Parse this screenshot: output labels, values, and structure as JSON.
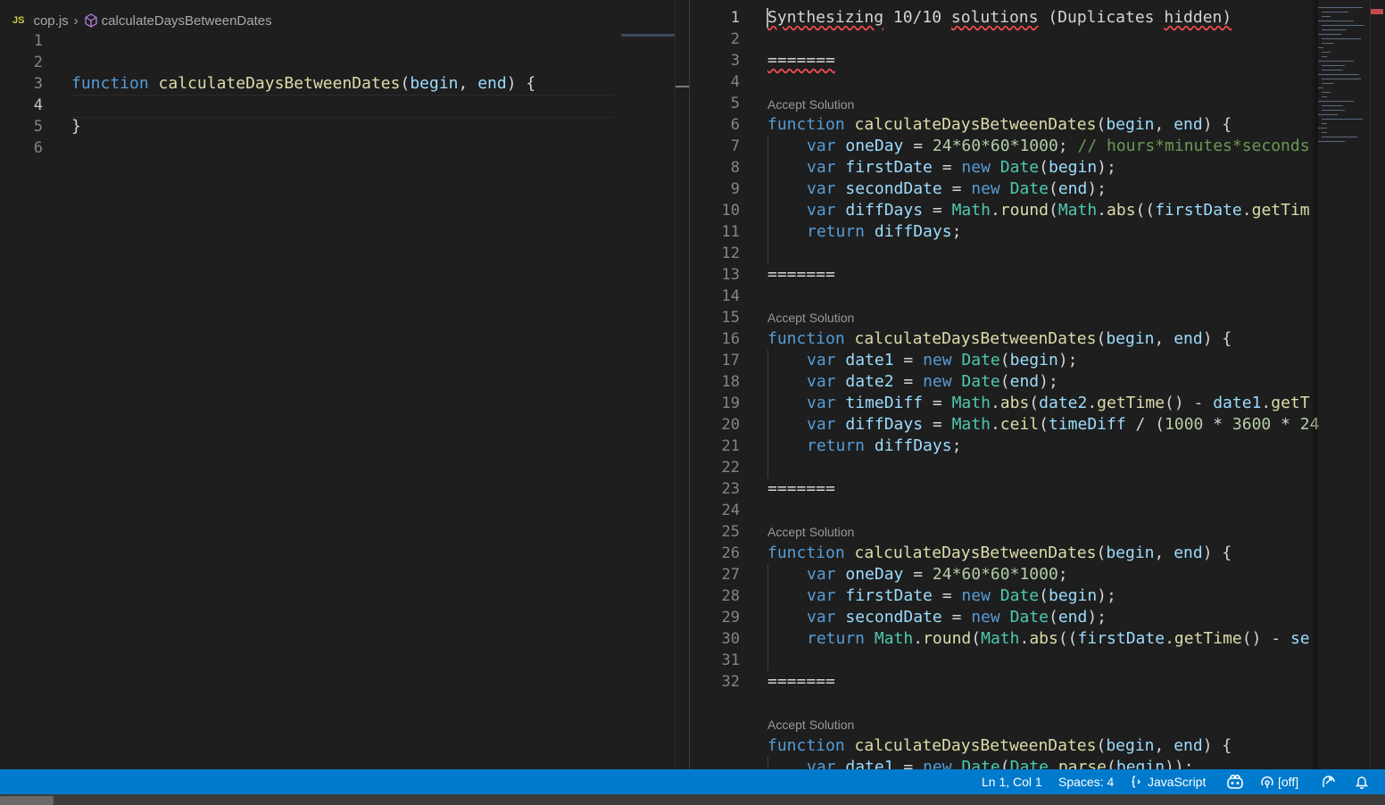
{
  "left_editor": {
    "breadcrumb": {
      "file_badge": "JS",
      "file_name": "cop.js",
      "symbol": "calculateDaysBetweenDates"
    },
    "line_numbers": [
      "1",
      "2",
      "3",
      "4",
      "5",
      "6"
    ],
    "active_line": "4",
    "code": {
      "l3_keyword": "function",
      "l3_name": "calculateDaysBetweenDates",
      "l3_open": "(",
      "l3_param1": "begin",
      "l3_comma": ", ",
      "l3_param2": "end",
      "l3_close": ") {",
      "l5": "}"
    }
  },
  "right_editor": {
    "header_words": [
      "Synthesizing",
      "10/10",
      "solutions",
      "(Duplicates",
      "hidden)"
    ],
    "separator": "=======",
    "accept_label": "Accept Solution",
    "line_numbers": [
      "1",
      "2",
      "3",
      "4",
      "5",
      "6",
      "7",
      "8",
      "9",
      "10",
      "11",
      "12",
      "13",
      "14",
      "15",
      "16",
      "17",
      "18",
      "19",
      "20",
      "21",
      "22",
      "23",
      "24",
      "25",
      "26",
      "27",
      "28",
      "29",
      "30",
      "31",
      "32"
    ],
    "sig": {
      "kw": "function",
      "name": "calculateDaysBetweenDates",
      "open": "(",
      "p1": "begin",
      "comma": ", ",
      "p2": "end",
      "close": ") {"
    },
    "s1": {
      "l6": {
        "kw": "var",
        "v": "oneDay",
        "rest": " = ",
        "n": "24*60*60*1000",
        "semi": "; ",
        "cmt": "// hours*minutes*seconds"
      },
      "l7": {
        "kw": "var",
        "v": "firstDate",
        "eq": " = ",
        "new": "new",
        "cls": "Date",
        "args": "(",
        "arg": "begin",
        "end": ");"
      },
      "l8": {
        "kw": "var",
        "v": "secondDate",
        "eq": " = ",
        "new": "new",
        "cls": "Date",
        "args": "(",
        "arg": "end",
        "end": ");"
      },
      "l9": {
        "kw": "var",
        "v": "diffDays",
        "eq": " = ",
        "m1": "Math",
        "d1": ".",
        "f1": "round",
        "o1": "(",
        "m2": "Math",
        "d2": ".",
        "f2": "abs",
        "o2": "((",
        "v2": "firstDate",
        "d3": ".",
        "f3": "getTim"
      },
      "l10": {
        "kw": "return",
        "v": "diffDays",
        "semi": ";"
      }
    },
    "s2": {
      "l15": {
        "kw": "var",
        "v": "date1",
        "eq": " = ",
        "new": "new",
        "cls": "Date",
        "o": "(",
        "arg": "begin",
        "end": ");"
      },
      "l16": {
        "kw": "var",
        "v": "date2",
        "eq": " = ",
        "new": "new",
        "cls": "Date",
        "o": "(",
        "arg": "end",
        "end": ");"
      },
      "l17": {
        "kw": "var",
        "v": "timeDiff",
        "eq": " = ",
        "m": "Math",
        "d": ".",
        "f": "abs",
        "o": "(",
        "v2": "date2",
        "d2": ".",
        "f2": "getTime",
        "o2": "() - ",
        "v3": "date1",
        "d3": ".",
        "f3": "getT"
      },
      "l18": {
        "kw": "var",
        "v": "diffDays",
        "eq": " = ",
        "m": "Math",
        "d": ".",
        "f": "ceil",
        "o": "(",
        "v2": "timeDiff",
        "op": " / (",
        "n1": "1000",
        "x1": " * ",
        "n2": "3600",
        "x2": " * ",
        "n3": "24"
      },
      "l19": {
        "kw": "return",
        "v": "diffDays",
        "semi": ";"
      }
    },
    "s3": {
      "l24": {
        "kw": "var",
        "v": "oneDay",
        "eq": " = ",
        "n": "24*60*60*1000",
        "semi": ";"
      },
      "l25": {
        "kw": "var",
        "v": "firstDate",
        "eq": " = ",
        "new": "new",
        "cls": "Date",
        "o": "(",
        "arg": "begin",
        "end": ");"
      },
      "l26": {
        "kw": "var",
        "v": "secondDate",
        "eq": " = ",
        "new": "new",
        "cls": "Date",
        "o": "(",
        "arg": "end",
        "end": ");"
      },
      "l27": {
        "kw": "return",
        "m": "Math",
        "d": ".",
        "f": "round",
        "o": "(",
        "m2": "Math",
        "d2": ".",
        "f2": "abs",
        "o2": "((",
        "v2": "firstDate",
        "d3": ".",
        "f3": "getTime",
        "o3": "() - ",
        "v3": "se"
      }
    },
    "s4": {
      "l32": {
        "kw": "var",
        "v": "date1",
        "eq": " = ",
        "new": "new",
        "cls": "Date",
        "o": "(",
        "m": "Date",
        "d": ".",
        "f": "parse",
        "o2": "(",
        "arg": "begin",
        "end": "));"
      }
    }
  },
  "statusbar": {
    "position": "Ln 1, Col 1",
    "spaces": "Spaces: 4",
    "language": "JavaScript",
    "live_share": "[off]"
  },
  "colors": {
    "statusbar": "#007acc",
    "editor_bg": "#1e1e1e",
    "keyword": "#569cd6",
    "function": "#dcdcaa",
    "variable": "#9cdcfe",
    "class": "#4ec9b0",
    "comment": "#6a9955",
    "number": "#b5cea8"
  }
}
